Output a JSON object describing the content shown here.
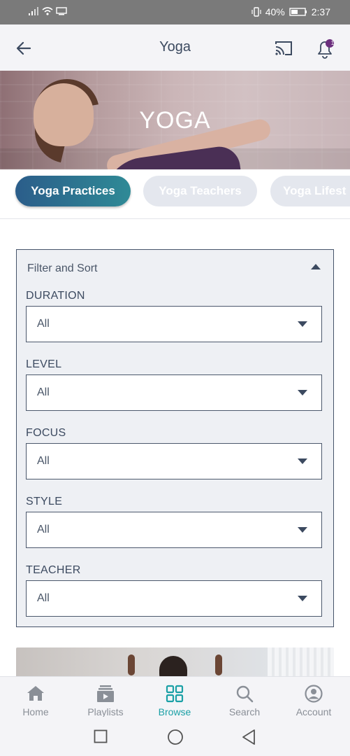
{
  "status_bar": {
    "battery": "40%",
    "time": "2:37"
  },
  "app_bar": {
    "title": "Yoga",
    "notification_count": "1"
  },
  "hero": {
    "title": "YOGA"
  },
  "category_tabs": [
    {
      "label": "Yoga Practices"
    },
    {
      "label": "Yoga Teachers"
    },
    {
      "label": "Yoga Lifest"
    }
  ],
  "filter": {
    "header": "Filter and Sort",
    "groups": [
      {
        "label": "DURATION",
        "value": "All"
      },
      {
        "label": "LEVEL",
        "value": "All"
      },
      {
        "label": "FOCUS",
        "value": "All"
      },
      {
        "label": "STYLE",
        "value": "All"
      },
      {
        "label": "TEACHER",
        "value": "All"
      }
    ]
  },
  "bottom_nav": [
    {
      "label": "Home",
      "icon": "home-icon"
    },
    {
      "label": "Playlists",
      "icon": "playlists-icon"
    },
    {
      "label": "Browse",
      "icon": "browse-icon",
      "active": true
    },
    {
      "label": "Search",
      "icon": "search-icon"
    },
    {
      "label": "Account",
      "icon": "account-icon"
    }
  ],
  "colors": {
    "accent": "#1aa0a6",
    "chip_active_start": "#2b5d8a",
    "chip_active_end": "#2f8a96",
    "text_dark": "#3c4a60"
  }
}
